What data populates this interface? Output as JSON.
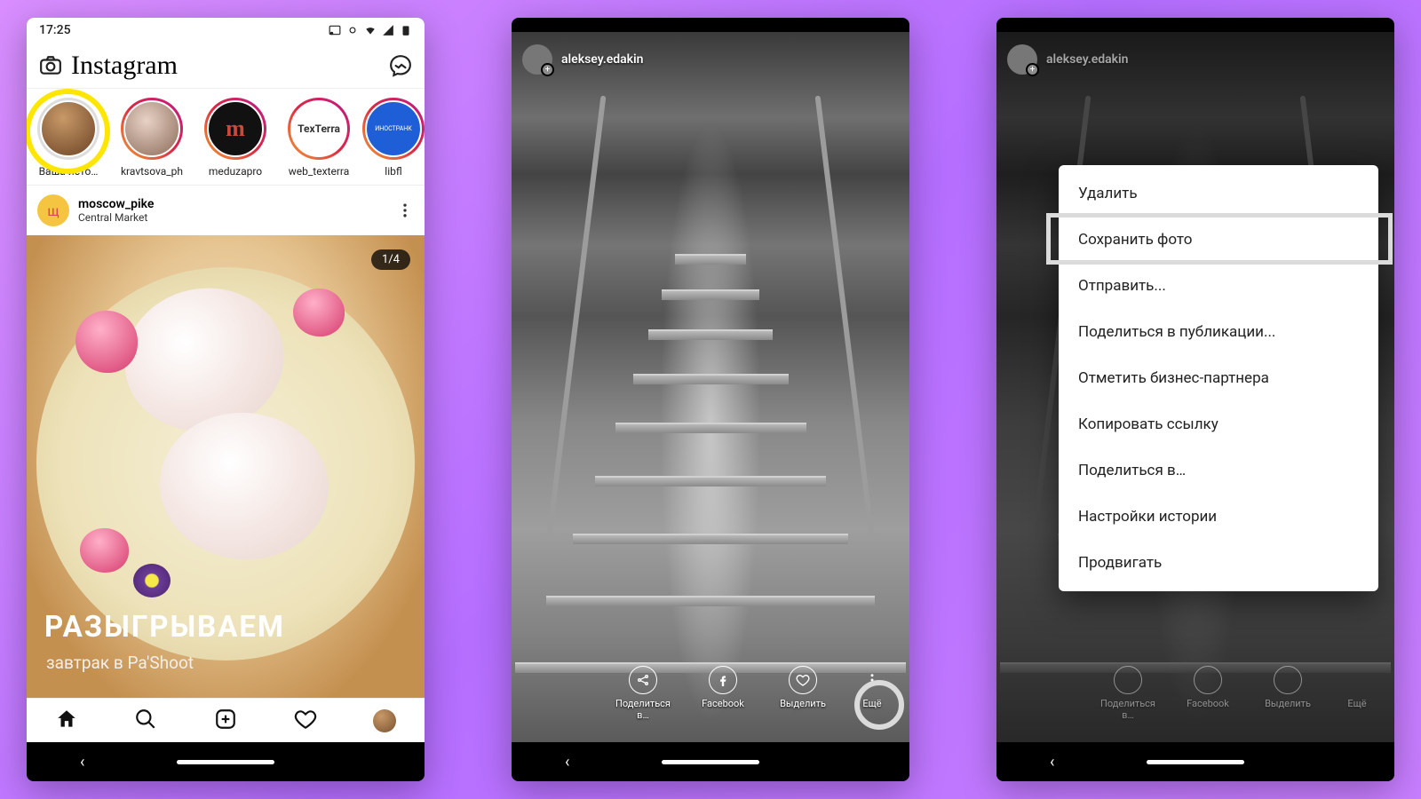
{
  "screen1": {
    "time": "17:25",
    "app": "Instagram",
    "stories": [
      {
        "name": "Ваша исто…"
      },
      {
        "name": "kravtsova_ph"
      },
      {
        "name": "meduzapro"
      },
      {
        "name": "web_texterra",
        "logo": "TexTerra"
      },
      {
        "name": "libfl",
        "logo": "ИНОСТРАНК"
      }
    ],
    "post": {
      "avatar_letter": "щ",
      "user": "moscow_pike",
      "location": "Central Market",
      "counter": "1/4",
      "caption1": "РАЗЫГРЫВАЕМ",
      "caption2": "завтрак в Pa'Shoot"
    }
  },
  "story": {
    "user": "aleksey.edakin",
    "actions": [
      {
        "label": "Поделиться в…"
      },
      {
        "label": "Facebook"
      },
      {
        "label": "Выделить"
      },
      {
        "label": "Ещё"
      }
    ]
  },
  "menu": {
    "items": [
      "Удалить",
      "Сохранить фото",
      "Отправить...",
      "Поделиться в публикации...",
      "Отметить бизнес-партнера",
      "Копировать ссылку",
      "Поделиться в…",
      "Настройки истории",
      "Продвигать"
    ],
    "highlight_index": 1
  }
}
